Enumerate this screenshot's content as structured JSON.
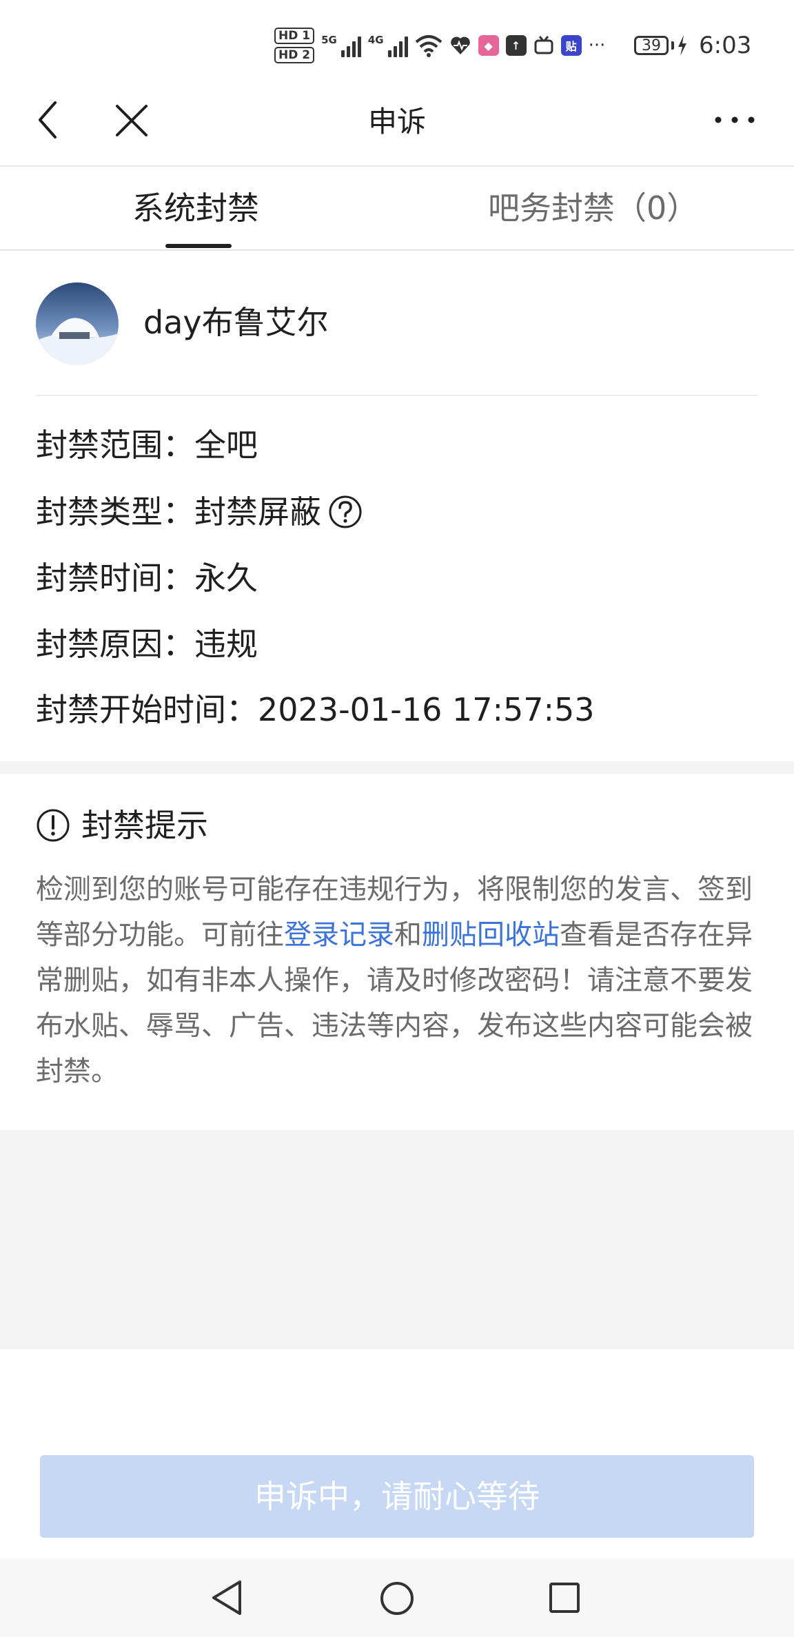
{
  "status_bar": {
    "hd1": "HD 1",
    "hd2": "HD 2",
    "signal1_label": "5G",
    "signal2_label": "4G",
    "app_icon_tieba": "贴",
    "more": "···",
    "battery": "39",
    "time": "6:03"
  },
  "nav": {
    "title": "申诉"
  },
  "tabs": {
    "system_ban": "系统封禁",
    "bar_ban": "吧务封禁（0）"
  },
  "user": {
    "name": "day布鲁艾尔"
  },
  "ban_info": {
    "scope_label": "封禁范围：",
    "scope_value": "全吧",
    "type_label": "封禁类型：",
    "type_value": "封禁屏蔽",
    "duration_label": "封禁时间：",
    "duration_value": "永久",
    "reason_label": "封禁原因：",
    "reason_value": "违规",
    "start_label": "封禁开始时间：",
    "start_value": "2023-01-16 17:57:53"
  },
  "tip": {
    "title": "封禁提示",
    "text_1": "检测到您的账号可能存在违规行为，将限制您的发言、签到等部分功能。可前往",
    "link_login": "登录记录",
    "text_and": "和",
    "link_recycle": "删贴回收站",
    "text_2": "查看是否存在异常删贴，如有非本人操作，请及时修改密码！请注意不要发布水贴、辱骂、广告、违法等内容，发布这些内容可能会被封禁。"
  },
  "appeal_button": "申诉中，请耐心等待",
  "icons": {
    "back": "back-arrow-icon",
    "close": "close-icon",
    "more": "more-dots-icon",
    "help": "question-circle-icon",
    "info": "exclamation-circle-icon",
    "sys_back": "triangle-back-icon",
    "sys_home": "circle-home-icon",
    "sys_recent": "square-recent-icon"
  },
  "colors": {
    "link": "#3b73d6",
    "button_bg": "#c6d8f3",
    "muted_text": "#6b6b6b"
  }
}
